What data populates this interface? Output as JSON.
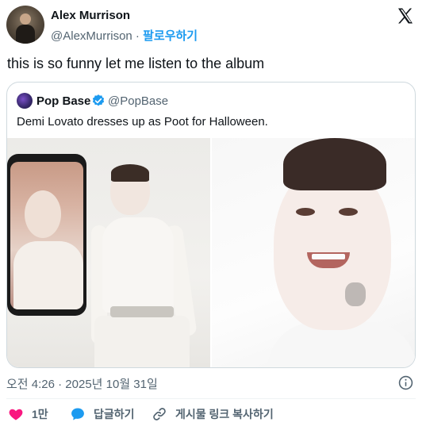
{
  "author": {
    "name": "Alex Murrison",
    "handle": "@AlexMurrison",
    "separator": " · ",
    "follow_label": "팔로우하기"
  },
  "tweet": {
    "text": "this is so funny let me listen to the album"
  },
  "quoted": {
    "name": "Pop Base",
    "handle": "@PopBase",
    "text": "Demi Lovato dresses up as Poot for Halloween."
  },
  "meta": {
    "timestamp": "오전 4:26 · 2025년 10월 31일"
  },
  "actions": {
    "like_count": "1만",
    "reply_label": "답글하기",
    "copy_link_label": "게시물 링크 복사하기"
  },
  "colors": {
    "like": "#f91880",
    "reply": "#1d9bf0",
    "follow": "#1d9bf0",
    "verified": "#1d9bf0"
  },
  "icons": [
    "x-logo-icon",
    "verified-badge-icon",
    "info-icon",
    "heart-icon",
    "reply-bubble-icon",
    "link-icon"
  ]
}
